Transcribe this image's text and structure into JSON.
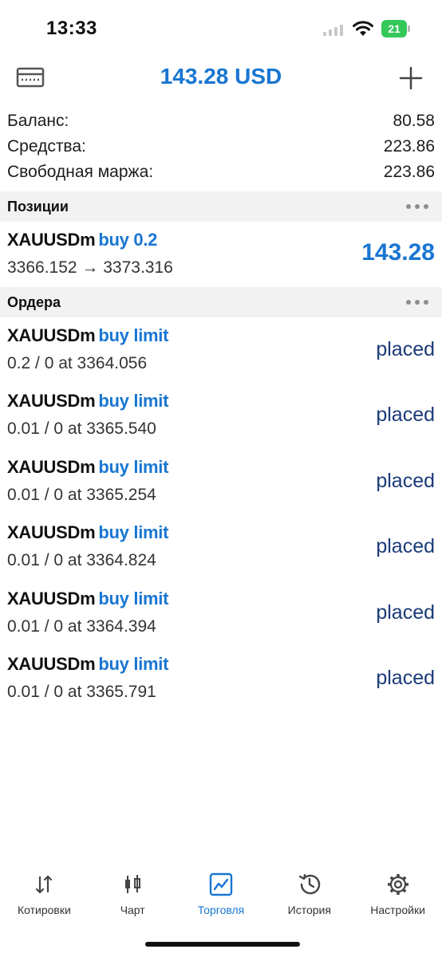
{
  "status_bar": {
    "time": "13:33",
    "battery": "21"
  },
  "header": {
    "title": "143.28 USD",
    "left_icon": "account-card-icon",
    "right_icon": "plus-icon"
  },
  "account": [
    {
      "label": "Баланс:",
      "value": "80.58"
    },
    {
      "label": "Средства:",
      "value": "223.86"
    },
    {
      "label": "Свободная маржа:",
      "value": "223.86"
    }
  ],
  "positions": {
    "title": "Позиции",
    "items": [
      {
        "symbol": "XAUUSDm",
        "type": "buy 0.2",
        "detail": "3366.152 → 3373.316",
        "profit": "143.28"
      }
    ]
  },
  "orders": {
    "title": "Ордера",
    "items": [
      {
        "symbol": "XAUUSDm",
        "type": "buy limit",
        "detail": "0.2 / 0 at 3364.056",
        "status": "placed"
      },
      {
        "symbol": "XAUUSDm",
        "type": "buy limit",
        "detail": "0.01 / 0 at 3365.540",
        "status": "placed"
      },
      {
        "symbol": "XAUUSDm",
        "type": "buy limit",
        "detail": "0.01 / 0 at 3365.254",
        "status": "placed"
      },
      {
        "symbol": "XAUUSDm",
        "type": "buy limit",
        "detail": "0.01 / 0 at 3364.824",
        "status": "placed"
      },
      {
        "symbol": "XAUUSDm",
        "type": "buy limit",
        "detail": "0.01 / 0 at 3364.394",
        "status": "placed"
      },
      {
        "symbol": "XAUUSDm",
        "type": "buy limit",
        "detail": "0.01 / 0 at 3365.791",
        "status": "placed"
      }
    ]
  },
  "tabs": [
    {
      "label": "Котировки",
      "icon": "quotes-arrows-icon",
      "active": false
    },
    {
      "label": "Чарт",
      "icon": "candlestick-chart-icon",
      "active": false
    },
    {
      "label": "Торговля",
      "icon": "trade-chart-icon",
      "active": true
    },
    {
      "label": "История",
      "icon": "history-clock-icon",
      "active": false
    },
    {
      "label": "Настройки",
      "icon": "settings-gear-icon",
      "active": false
    }
  ],
  "colors": {
    "accent": "#1976d2",
    "placed_text": "#1b3a78",
    "section_bg": "#f2f2f2",
    "battery": "#34c759"
  }
}
